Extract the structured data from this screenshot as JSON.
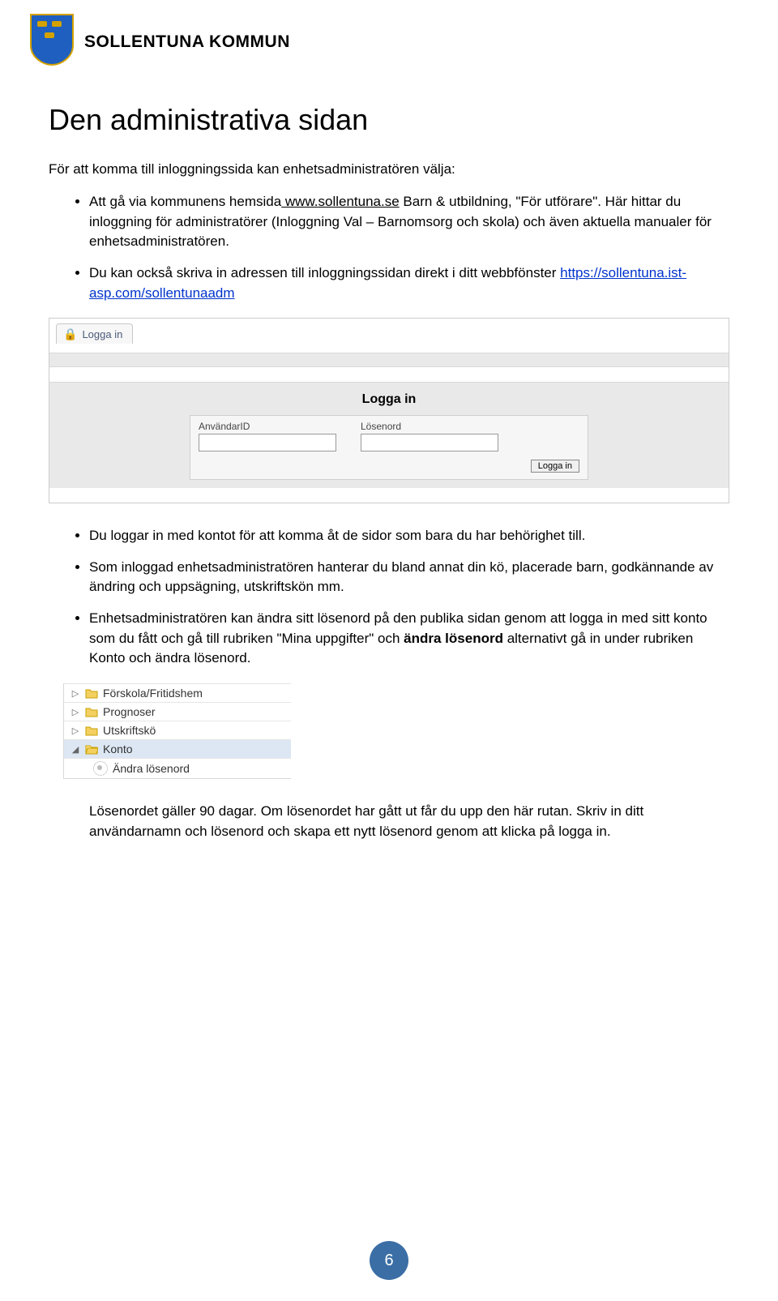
{
  "brand": {
    "name": "SOLLENTUNA KOMMUN"
  },
  "heading": "Den administrativa sidan",
  "lead": "För att komma till inloggningssida kan enhetsadministratören välja:",
  "bullets_top": [
    {
      "prefix": "Att gå via kommunens hemsida",
      "link": " www.sollentuna.se",
      "mid": "  Barn & utbildning, \"För utförare\".  Här hittar du inloggning för administratörer (Inloggning Val – Barnomsorg och skola) och även aktuella manualer för enhetsadministratören."
    },
    {
      "prefix": " Du kan också skriva in adressen till inloggningssidan direkt i ditt webbfönster ",
      "link": "https://sollentuna.ist-asp.com/sollentunaadm"
    }
  ],
  "login": {
    "tab": "Logga in",
    "title": "Logga in",
    "userLabel": "AnvändarID",
    "passLabel": "Lösenord",
    "submit": "Logga in"
  },
  "bullets_mid": [
    "Du loggar in med kontot för att komma åt de sidor som bara du har behörighet till.",
    "Som inloggad enhetsadministratören hanterar du bland annat din kö, placerade barn, godkännande av ändring och uppsägning, utskriftskön mm.",
    {
      "pre": "Enhetsadministratören kan ändra sitt lösenord på den publika sidan genom att logga in med sitt konto som du fått och gå till rubriken \"Mina uppgifter\" och ",
      "bold1": "ändra lösenord",
      "post": " alternativt gå in under rubriken Konto och ändra lösenord."
    }
  ],
  "tree": [
    {
      "label": "Förskola/Fritidshem",
      "caret": "▷",
      "selected": false
    },
    {
      "label": "Prognoser",
      "caret": "▷",
      "selected": false
    },
    {
      "label": "Utskriftskö",
      "caret": "▷",
      "selected": false
    },
    {
      "label": "Konto",
      "caret": "◢",
      "selected": true
    },
    {
      "label": "Ändra lösenord",
      "caret": "",
      "selected": false,
      "child": true
    }
  ],
  "final": "Lösenordet gäller 90 dagar. Om lösenordet har gått ut får du upp den här rutan. Skriv in ditt användarnamn och lösenord och skapa ett nytt lösenord genom att klicka på logga in.",
  "pageNum": "6"
}
